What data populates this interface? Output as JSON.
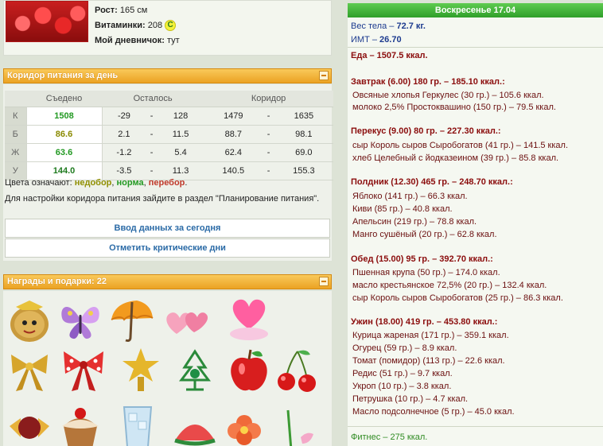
{
  "profile": {
    "height_label": "Рост:",
    "height_value": "165 см",
    "vitamins_label": "Витаминки:",
    "vitamins_value": "208",
    "vitamin_badge": "C",
    "diary_label": "Мой дневничок:",
    "diary_value": "тут"
  },
  "corridor": {
    "title": "Коридор питания за день",
    "headers": [
      "Съедено",
      "Осталось",
      "Коридор"
    ],
    "rows": [
      {
        "label": "К",
        "eaten": "1508",
        "left_min": "-29",
        "left_max": "128",
        "range_min": "1479",
        "range_max": "1635"
      },
      {
        "label": "Б",
        "eaten": "86.6",
        "left_min": "2.1",
        "left_max": "11.5",
        "range_min": "88.7",
        "range_max": "98.1"
      },
      {
        "label": "Ж",
        "eaten": "63.6",
        "left_min": "-1.2",
        "left_max": "5.4",
        "range_min": "62.4",
        "range_max": "69.0"
      },
      {
        "label": "У",
        "eaten": "144.0",
        "left_min": "-3.5",
        "left_max": "11.3",
        "range_min": "140.5",
        "range_max": "155.3"
      }
    ],
    "dash": "-",
    "colors_prefix": "Цвета означают:",
    "color_under": "недобор",
    "color_norm": "норма",
    "color_over": "перебор",
    "hint": "Для настройки коридора питания зайдите в раздел \"Планирование питания\".",
    "btn_input": "Ввод данных за сегодня",
    "btn_critical": "Отметить критические дни"
  },
  "gifts": {
    "title": "Награды и подарки: 22"
  },
  "day": {
    "title": "Воскресенье 17.04",
    "weight": "Вес тела",
    "weight_value": "72.7 кг.",
    "bmi": "ИМТ",
    "bmi_value": "26.70",
    "food": "Еда – 1507.5 ккал.",
    "meals": [
      {
        "title": "Завтрак (6.00) 180 гр. – 185.10 ккал.:",
        "items": [
          "Овсяные хлопья Геркулес (30 гр.) – 105.6 ккал.",
          "молоко 2,5% Простоквашино (150 гр.) – 79.5 ккал."
        ]
      },
      {
        "title": "Перекус (9.00) 80 гр. – 227.30 ккал.:",
        "items": [
          "сыр Король сыров Сыробогатов (41 гр.) – 141.5 ккал.",
          "хлеб Целебный с йодказеином (39 гр.) – 85.8 ккал."
        ]
      },
      {
        "title": "Полдник (12.30) 465 гр. – 248.70 ккал.:",
        "items": [
          "Яблоко (141 гр.) – 66.3 ккал.",
          "Киви (85 гр.) – 40.8 ккал.",
          "Апельсин (219 гр.) – 78.8 ккал.",
          "Манго сушёный (20 гр.) – 62.8 ккал."
        ]
      },
      {
        "title": "Обед (15.00) 95 гр. – 392.70 ккал.:",
        "items": [
          "Пшенная крупа (50 гр.) – 174.0 ккал.",
          "масло крестьянское 72,5% (20 гр.) – 132.4 ккал.",
          "сыр Король сыров Сыробогатов (25 гр.) – 86.3 ккал."
        ]
      },
      {
        "title": "Ужин (18.00) 419 гр. – 453.80 ккал.:",
        "items": [
          "Курица жареная (171 гр.) – 359.1 ккал.",
          "Огурец (59 гр.) – 8.9 ккал.",
          "Томат (помидор) (113 гр.) – 22.6 ккал.",
          "Редис (51 гр.) – 9.7 ккал.",
          "Укроп (10 гр.) – 3.8 ккал.",
          "Петрушка (10 гр.) – 4.7 ккал.",
          "Масло подсолнечное (5 гр.) – 45.0 ккал."
        ]
      }
    ],
    "fitness": "Фитнес – 275 ккал."
  }
}
